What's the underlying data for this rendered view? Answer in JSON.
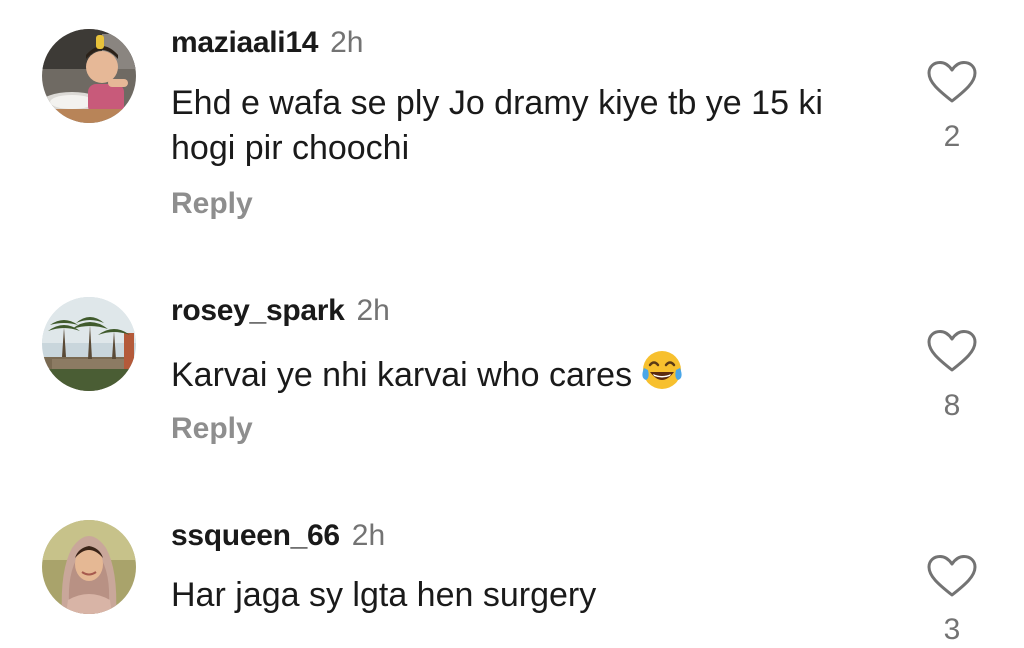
{
  "comments": [
    {
      "username": "maziaali14",
      "time": "2h",
      "text": "Ehd e wafa se ply Jo dramy kiye tb ye 15 ki hogi pir choochi",
      "reply_label": "Reply",
      "likes": "2",
      "avatar_icon": "child-photo-avatar"
    },
    {
      "username": "rosey_spark",
      "time": "2h",
      "text": "Karvai ye nhi karvai who cares",
      "emoji_icon": "face-with-tears-of-joy-icon",
      "reply_label": "Reply",
      "likes": "8",
      "avatar_icon": "palm-trees-photo-avatar"
    },
    {
      "username": "ssqueen_66",
      "time": "2h",
      "text": "Har jaga sy lgta hen surgery",
      "likes": "3",
      "avatar_icon": "woman-portrait-avatar"
    }
  ],
  "colors": {
    "username": "#1a1a1a",
    "secondary": "#737373",
    "reply": "#8e8e8e",
    "background": "#ffffff"
  }
}
